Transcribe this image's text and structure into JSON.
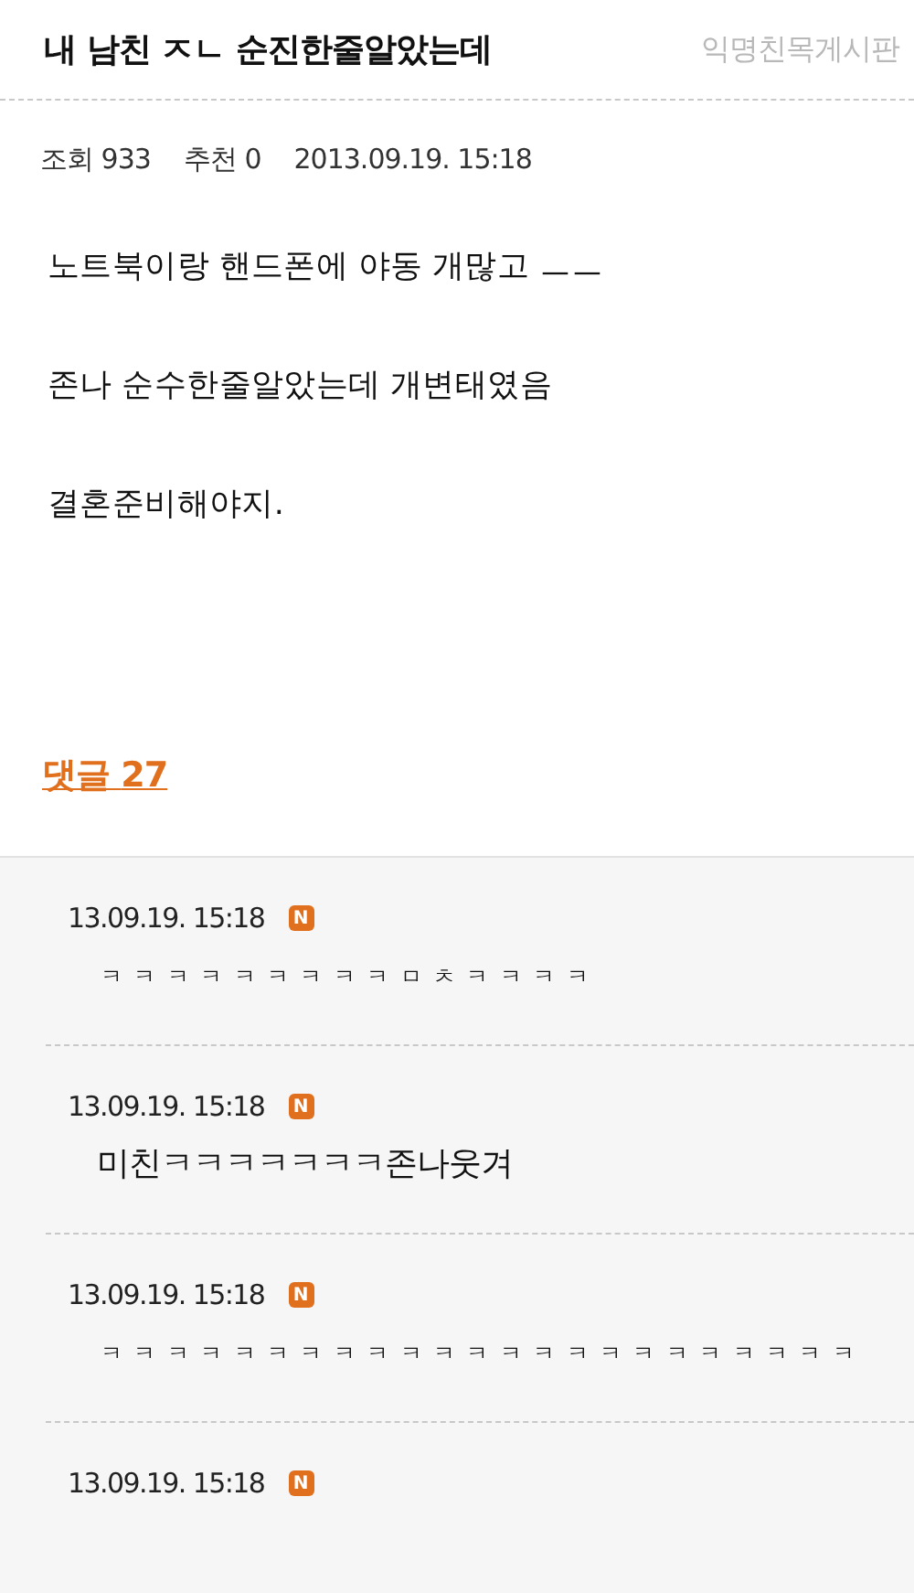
{
  "post": {
    "title": "내 남친 ㅈㄴ 순진한줄알았는데",
    "board": "익명친목게시판",
    "views_label": "조회",
    "views": "933",
    "likes_label": "추천",
    "likes": "0",
    "date": "2013.09.19. 15:18",
    "paragraphs": [
      "노트북이랑 핸드폰에 야동 개많고 ㅡㅡ",
      "존나 순수한줄알았는데 개변태였음",
      "결혼준비해야지."
    ]
  },
  "comments_link": {
    "label": "댓글",
    "count": "27"
  },
  "comments": [
    {
      "date": "13.09.19. 15:18",
      "badge": "N",
      "text": "ㅋㅋㅋㅋㅋㅋㅋㅋㅋㅁㅊㅋㅋㅋㅋ",
      "kind": "jamo"
    },
    {
      "date": "13.09.19. 15:18",
      "badge": "N",
      "text": "미친ㅋㅋㅋㅋㅋㅋㅋ존나웃겨",
      "kind": "mixed"
    },
    {
      "date": "13.09.19. 15:18",
      "badge": "N",
      "text": "ㅋㅋㅋㅋㅋㅋㅋㅋㅋㅋㅋㅋㅋㅋㅋㅋㅋㅋㅋㅋㅋㅋㅋ",
      "kind": "jamo"
    },
    {
      "date": "13.09.19. 15:18",
      "badge": "N"
    }
  ]
}
